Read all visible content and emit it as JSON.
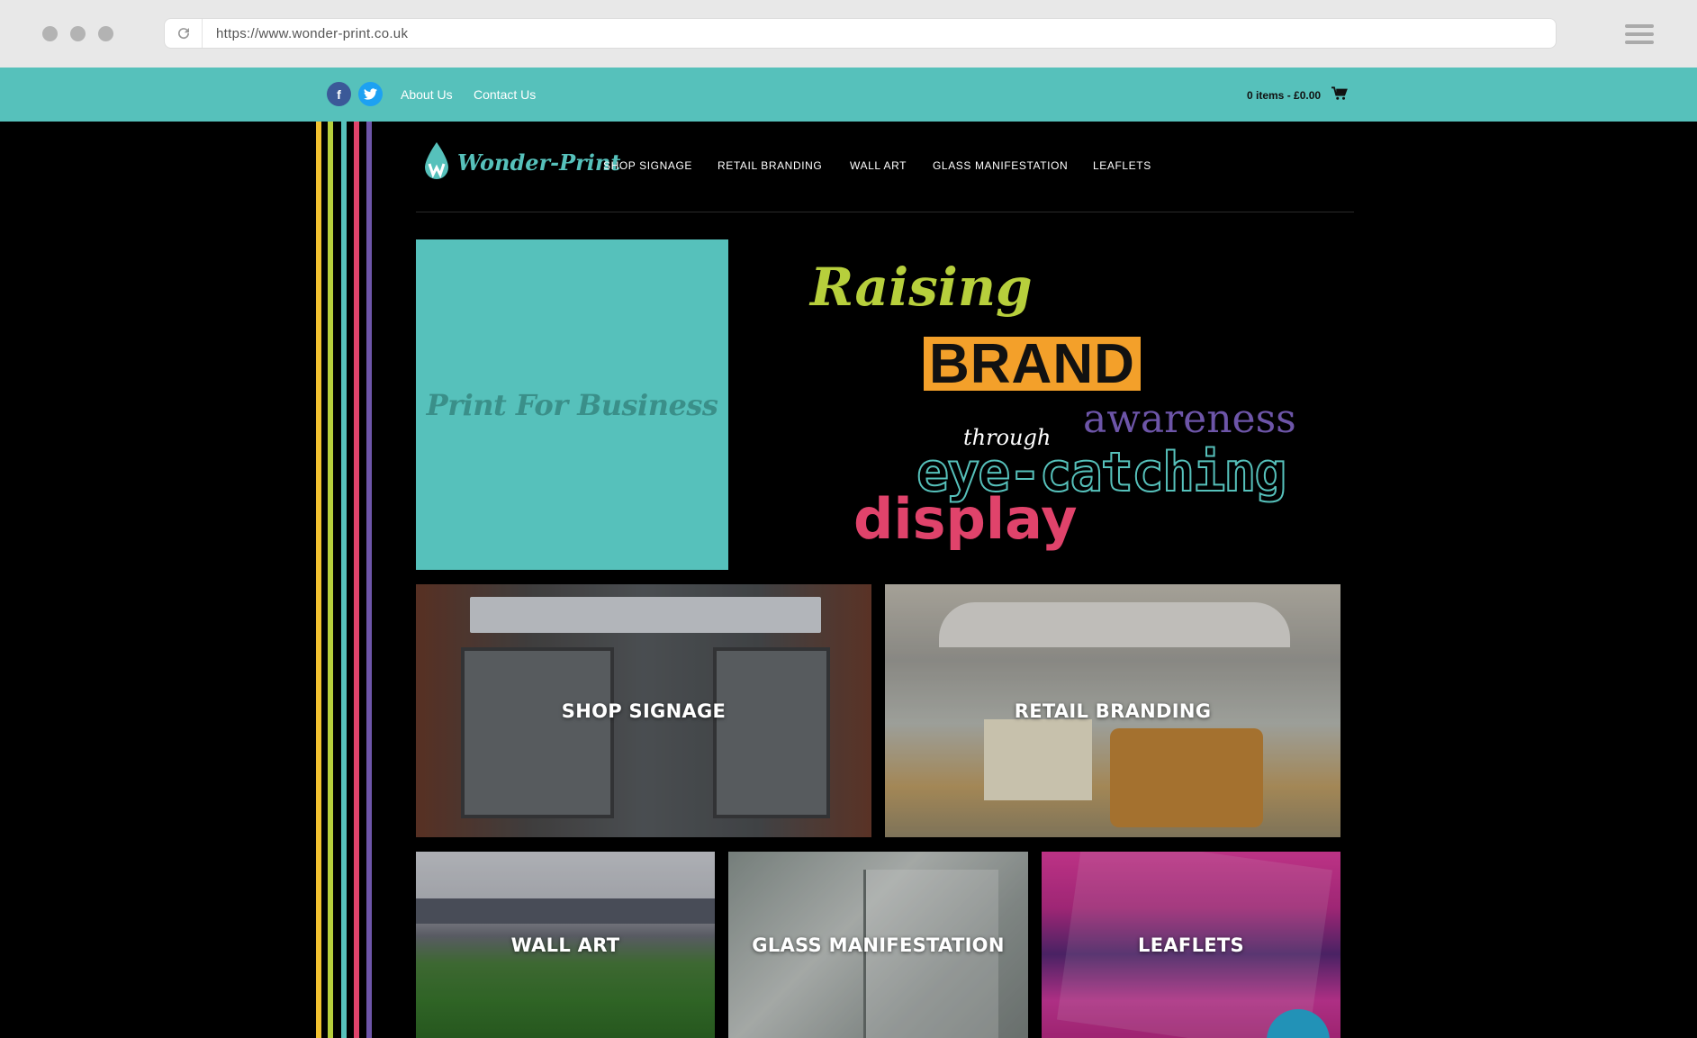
{
  "browser": {
    "url": "https://www.wonder-print.co.uk"
  },
  "topbar": {
    "links": [
      "About Us",
      "Contact Us"
    ],
    "cart": "0 items - £0.00",
    "social": [
      "f",
      "t"
    ]
  },
  "nav": {
    "logo_text": "Wonder-Print",
    "items": [
      "SHOP SIGNAGE",
      "RETAIL BRANDING",
      "WALL ART",
      "GLASS MANIFESTATION",
      "LEAFLETS"
    ]
  },
  "hero": {
    "box_text": "Print For Business",
    "words": {
      "raising": "Raising",
      "brand": "BRAND",
      "awareness": "awareness",
      "through": "through",
      "eye_catching": "eye-catching",
      "display": "display"
    }
  },
  "tiles": [
    "SHOP SIGNAGE",
    "RETAIL BRANDING",
    "WALL ART",
    "GLASS MANIFESTATION",
    "LEAFLETS"
  ],
  "colors": {
    "teal": "#56c1bb",
    "stripe_yellow": "#f2c230",
    "stripe_lime": "#b7cf3c",
    "stripe_teal": "#56c1bb",
    "stripe_red": "#e0436b",
    "stripe_purple": "#6d55a8",
    "brand_orange": "#f3a02a"
  }
}
